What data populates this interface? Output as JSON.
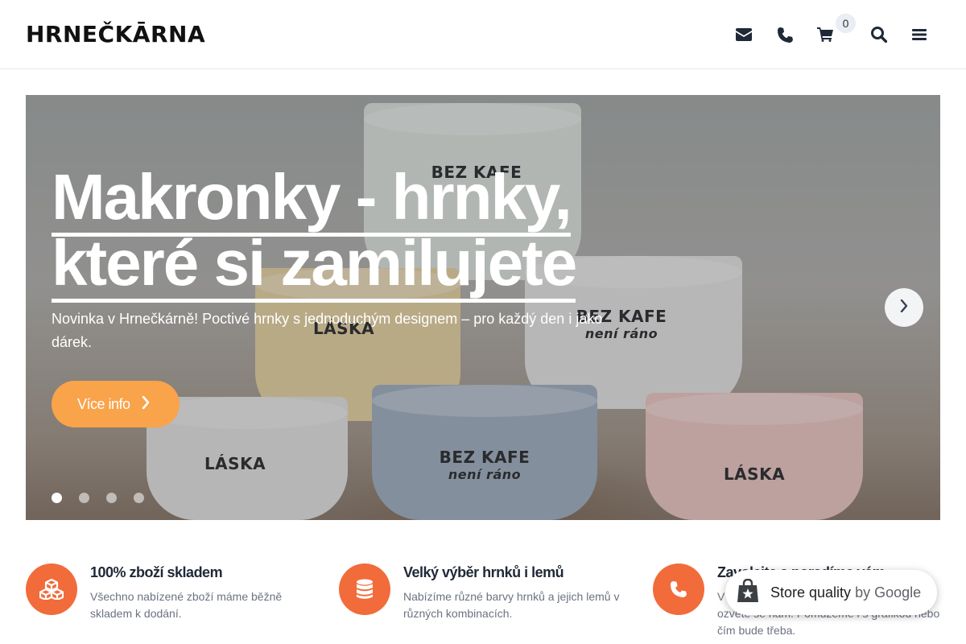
{
  "header": {
    "logo": "HRNEČKĀRNA",
    "icons": [
      "envelope-icon",
      "phone-icon",
      "cart-icon",
      "search-icon",
      "menu-icon"
    ],
    "cart_count": "0"
  },
  "hero": {
    "title_line1": "Makronky - hrnky,",
    "title_line2": "které si zamilujete",
    "subtitle": "Novinka v Hrnečkárně! Poctivé hrnky s jednoduchým designem – pro každý den i jako dárek.",
    "button_label": "Více info",
    "slides_total": 4,
    "active_slide": 1,
    "mug_labels": {
      "bez_kafe": "BEZ KAFE",
      "neni_rano": "není ráno",
      "laska": "LÁSKA"
    }
  },
  "features": [
    {
      "icon": "cubes-icon",
      "title": "100% zboží skladem",
      "description": "Všechno nabízené zboží máme běžně skladem k dodání."
    },
    {
      "icon": "database-icon",
      "title": "Velký výběr hrnků i lemů",
      "description": "Nabízíme různé barvy hrnků a jejich lemů v různých kombinacích."
    },
    {
      "icon": "phone-icon",
      "title": "Zavolejte a poradíme vám",
      "description": "V případě jakýchkoliv dotazů neváhejte a ozvěte se nám. Pomůžeme i s grafikou nebo čím bude třeba."
    }
  ],
  "google_badge": {
    "label": "Store quality",
    "by": "by Google"
  },
  "colors": {
    "accent_orange": "#f26b3a",
    "button_orange": "#f9a34a",
    "text_dark": "#1f2937",
    "text_muted": "#6b7280"
  }
}
